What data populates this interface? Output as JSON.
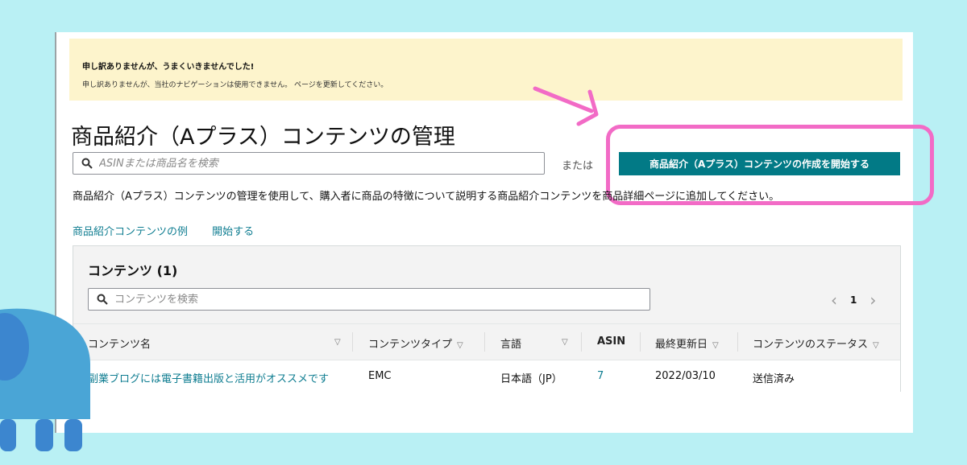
{
  "alert": {
    "title": "申し訳ありませんが、うまくいきませんでした!",
    "body": "申し訳ありませんが、当社のナビゲーションは使用できません。 ページを更新してください。"
  },
  "page": {
    "title": "商品紹介（Aプラス）コンテンツの管理",
    "search_placeholder": "ASINまたは商品名を検索",
    "or_text": "または",
    "create_button": "商品紹介（Aプラス）コンテンツの作成を開始する",
    "description": "商品紹介（Aプラス）コンテンツの管理を使用して、購入者に商品の特徴について説明する商品紹介コンテンツを商品詳細ページに追加してください。",
    "link_examples": "商品紹介コンテンツの例",
    "link_start": "開始する"
  },
  "contents": {
    "title": "コンテンツ (1)",
    "search_placeholder": "コンテンツを検索",
    "page_number": "1",
    "columns": [
      "コンテンツ名",
      "コンテンツタイプ",
      "言語",
      "ASIN",
      "最終更新日",
      "コンテンツのステータス"
    ],
    "rows": [
      {
        "name": "副業ブログには電子書籍出版と活用がオススメです",
        "type": "EMC",
        "language": "日本語（JP）",
        "asin": "7",
        "updated": "2022/03/10",
        "status": "送信済み"
      }
    ]
  },
  "colors": {
    "accent": "#027a86",
    "highlight": "#f26bc6",
    "background": "#b9f0f4",
    "link": "#0f7d91"
  },
  "icons": [
    "search-icon",
    "chevron-left-icon",
    "chevron-right-icon",
    "sort-icon",
    "arrow-icon",
    "elephant-icon"
  ]
}
